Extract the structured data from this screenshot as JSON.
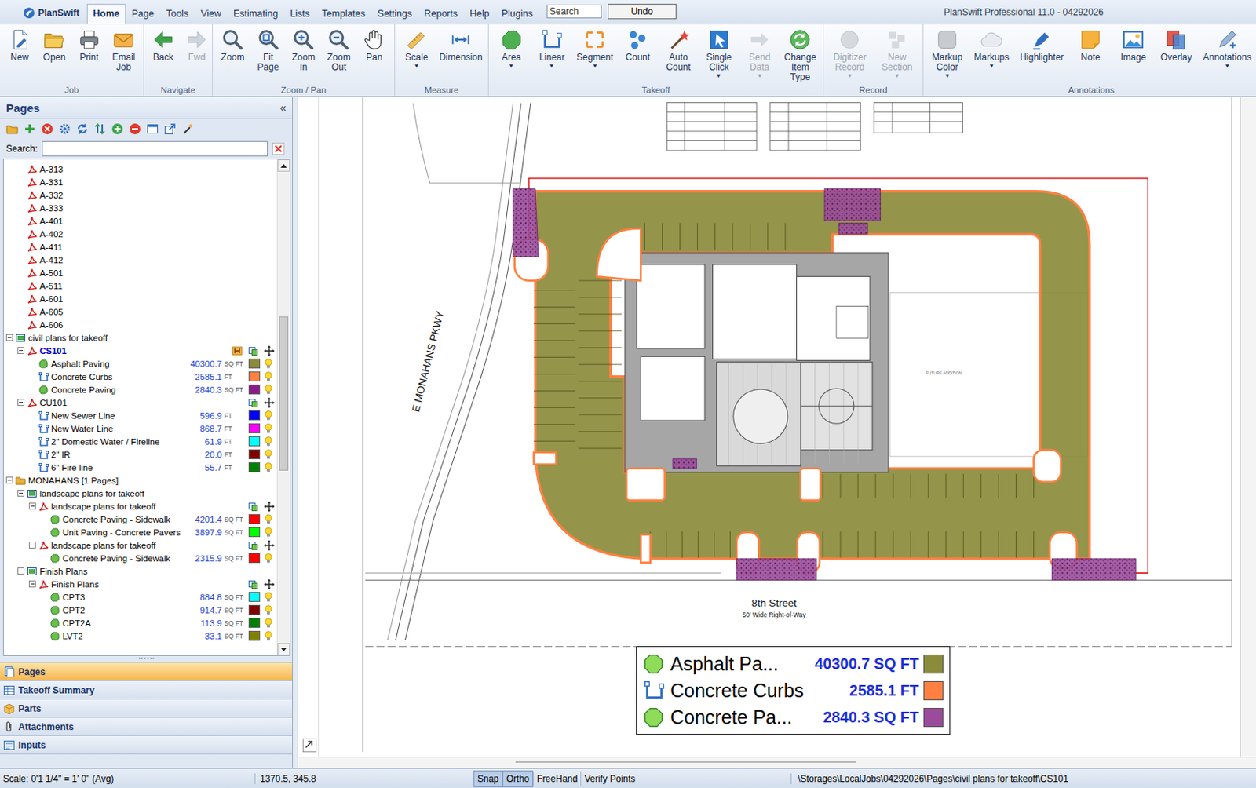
{
  "window": {
    "title": "PlanSwift Professional 11.0 - 04292026"
  },
  "menu": {
    "app": "PlanSwift",
    "tabs": [
      {
        "label": "Home",
        "selected": true
      },
      {
        "label": "Page",
        "selected": false
      },
      {
        "label": "Tools",
        "selected": false
      },
      {
        "label": "View",
        "selected": false
      },
      {
        "label": "Estimating",
        "selected": false
      },
      {
        "label": "Lists",
        "selected": false
      },
      {
        "label": "Templates",
        "selected": false
      },
      {
        "label": "Settings",
        "selected": false
      },
      {
        "label": "Reports",
        "selected": false
      },
      {
        "label": "Help",
        "selected": false
      },
      {
        "label": "Plugins",
        "selected": false
      }
    ],
    "search": {
      "placeholder": "Search"
    },
    "undo": "Undo"
  },
  "ribbon": {
    "groups": [
      {
        "label": "Job",
        "buttons": [
          {
            "label": "New",
            "disabled": false
          },
          {
            "label": "Open",
            "disabled": false
          },
          {
            "label": "Print",
            "disabled": false
          },
          {
            "label": "Email Job",
            "disabled": false
          }
        ]
      },
      {
        "label": "Navigate",
        "buttons": [
          {
            "label": "Back",
            "disabled": false
          },
          {
            "label": "Fwd",
            "disabled": true
          }
        ]
      },
      {
        "label": "Zoom / Pan",
        "buttons": [
          {
            "label": "Zoom",
            "disabled": false
          },
          {
            "label": "Fit Page",
            "disabled": false
          },
          {
            "label": "Zoom In",
            "disabled": false
          },
          {
            "label": "Zoom Out",
            "disabled": false
          },
          {
            "label": "Pan",
            "disabled": false
          }
        ]
      },
      {
        "label": "Measure",
        "buttons": [
          {
            "label": "Scale",
            "disabled": false,
            "arrow": "▾"
          },
          {
            "label": "Dimension",
            "disabled": false
          }
        ]
      },
      {
        "label": "Takeoff",
        "buttons": [
          {
            "label": "Area",
            "disabled": false,
            "arrow": "▾"
          },
          {
            "label": "Linear",
            "disabled": false,
            "arrow": "▾"
          },
          {
            "label": "Segment",
            "disabled": false,
            "arrow": "▾"
          },
          {
            "label": "Count",
            "disabled": false
          },
          {
            "label": "Auto Count",
            "disabled": false
          },
          {
            "label": "Single Click",
            "disabled": false,
            "arrow": "▾"
          },
          {
            "label": "Send Data",
            "disabled": true,
            "arrow": "▾"
          },
          {
            "label": "Change Item Type",
            "disabled": false
          }
        ]
      },
      {
        "label": "Record",
        "buttons": [
          {
            "label": "Digitizer Record",
            "disabled": true,
            "arrow": "▾"
          },
          {
            "label": "New Section",
            "disabled": true,
            "arrow": "▾"
          }
        ]
      },
      {
        "label": "Annotations",
        "buttons": [
          {
            "label": "Markup Color",
            "disabled": false,
            "arrow": "▾"
          },
          {
            "label": "Markups",
            "disabled": false,
            "arrow": "▾"
          },
          {
            "label": "Highlighter",
            "disabled": false
          },
          {
            "label": "Note",
            "disabled": false
          },
          {
            "label": "Image",
            "disabled": false
          },
          {
            "label": "Overlay",
            "disabled": false
          },
          {
            "label": "Annotations",
            "disabled": false,
            "arrow": "▾"
          }
        ]
      }
    ]
  },
  "pages_panel": {
    "title": "Pages",
    "collapse": "«",
    "search_label": "Search:",
    "tree": [
      {
        "label": "A-313",
        "level": 1,
        "kind": "pdf",
        "selected": false
      },
      {
        "label": "A-331",
        "level": 1,
        "kind": "pdf",
        "selected": false
      },
      {
        "label": "A-332",
        "level": 1,
        "kind": "pdf",
        "selected": false
      },
      {
        "label": "A-333",
        "level": 1,
        "kind": "pdf",
        "selected": false
      },
      {
        "label": "A-401",
        "level": 1,
        "kind": "pdf",
        "selected": false
      },
      {
        "label": "A-402",
        "level": 1,
        "kind": "pdf",
        "selected": false
      },
      {
        "label": "A-411",
        "level": 1,
        "kind": "pdf",
        "selected": false
      },
      {
        "label": "A-412",
        "level": 1,
        "kind": "pdf",
        "selected": false
      },
      {
        "label": "A-501",
        "level": 1,
        "kind": "pdf",
        "selected": false
      },
      {
        "label": "A-511",
        "level": 1,
        "kind": "pdf",
        "selected": false
      },
      {
        "label": "A-601",
        "level": 1,
        "kind": "pdf",
        "selected": false
      },
      {
        "label": "A-605",
        "level": 1,
        "kind": "pdf",
        "selected": false
      },
      {
        "label": "A-606",
        "level": 1,
        "kind": "pdf",
        "selected": false
      },
      {
        "label": "civil plans for takeoff",
        "level": 0,
        "kind": "job",
        "expanded": true,
        "selected": false
      },
      {
        "label": "CS101",
        "level": 1,
        "kind": "pdf",
        "expanded": true,
        "selected": true,
        "page_tools": true,
        "flagged": true
      },
      {
        "label": "Asphalt Paving",
        "level": 2,
        "kind": "area",
        "value": "40300.7",
        "unit": "SQ FT",
        "color": "#8b8b3c",
        "visible": true,
        "selected": false
      },
      {
        "label": "Concrete Curbs",
        "level": 2,
        "kind": "linear",
        "value": "2585.1",
        "unit": "FT",
        "color": "#ff8040",
        "visible": true,
        "selected": false
      },
      {
        "label": "Concrete Paving",
        "level": 2,
        "kind": "area",
        "value": "2840.3",
        "unit": "SQ FT",
        "color": "#8b1a8b",
        "visible": true,
        "selected": false
      },
      {
        "label": "CU101",
        "level": 1,
        "kind": "pdf",
        "expanded": true,
        "selected": false,
        "page_tools": true,
        "flagged": false
      },
      {
        "label": "New Sewer Line",
        "level": 2,
        "kind": "linear",
        "value": "596.9",
        "unit": "FT",
        "color": "#0000ff",
        "visible": true,
        "selected": false
      },
      {
        "label": "New Water Line",
        "level": 2,
        "kind": "linear",
        "value": "868.7",
        "unit": "FT",
        "color": "#ff00ff",
        "visible": true,
        "selected": false
      },
      {
        "label": "2\" Domestic Water / Fireline",
        "level": 2,
        "kind": "linear",
        "value": "61.9",
        "unit": "FT",
        "color": "#00ffff",
        "visible": true,
        "selected": false
      },
      {
        "label": "2\" IR",
        "level": 2,
        "kind": "linear",
        "value": "20.0",
        "unit": "FT",
        "color": "#800000",
        "visible": true,
        "selected": false
      },
      {
        "label": "6\" Fire line",
        "level": 2,
        "kind": "linear",
        "value": "55.7",
        "unit": "FT",
        "color": "#008000",
        "visible": true,
        "selected": false
      },
      {
        "label": "MONAHANS [1 Pages]",
        "level": 0,
        "kind": "folder",
        "expanded": true,
        "selected": false
      },
      {
        "label": "landscape plans for takeoff",
        "level": 1,
        "kind": "job",
        "expanded": true,
        "selected": false
      },
      {
        "label": "landscape plans for takeoff",
        "level": 2,
        "kind": "pdf",
        "expanded": true,
        "selected": false,
        "page_tools": true,
        "flagged": false
      },
      {
        "label": "Concrete Paving - Sidewalk",
        "level": 3,
        "kind": "area",
        "value": "4201.4",
        "unit": "SQ FT",
        "color": "#ff0000",
        "visible": true,
        "selected": false
      },
      {
        "label": "Unit Paving - Concrete Pavers",
        "level": 3,
        "kind": "area",
        "value": "3897.9",
        "unit": "SQ FT",
        "color": "#00ff00",
        "visible": true,
        "selected": false
      },
      {
        "label": "landscape plans for takeoff",
        "level": 2,
        "kind": "pdf",
        "expanded": true,
        "selected": false,
        "page_tools": true,
        "flagged": false
      },
      {
        "label": "Concrete Paving - Sidewalk",
        "level": 3,
        "kind": "area",
        "value": "2315.9",
        "unit": "SQ FT",
        "color": "#ff0000",
        "visible": true,
        "selected": false
      },
      {
        "label": "Finish Plans",
        "level": 1,
        "kind": "job",
        "expanded": true,
        "selected": false
      },
      {
        "label": "Finish Plans",
        "level": 2,
        "kind": "pdf",
        "expanded": true,
        "selected": false,
        "page_tools": true,
        "flagged": false
      },
      {
        "label": "CPT3",
        "level": 3,
        "kind": "area",
        "value": "884.8",
        "unit": "SQ FT",
        "color": "#00ffff",
        "visible": true,
        "selected": false
      },
      {
        "label": "CPT2",
        "level": 3,
        "kind": "area",
        "value": "914.7",
        "unit": "SQ FT",
        "color": "#800000",
        "visible": true,
        "selected": false
      },
      {
        "label": "CPT2A",
        "level": 3,
        "kind": "area",
        "value": "113.9",
        "unit": "SQ FT",
        "color": "#008000",
        "visible": true,
        "selected": false
      },
      {
        "label": "LVT2",
        "level": 3,
        "kind": "area",
        "value": "33.1",
        "unit": "SQ FT",
        "color": "#808000",
        "visible": true,
        "selected": false
      }
    ]
  },
  "accordion": [
    {
      "label": "Pages",
      "selected": true
    },
    {
      "label": "Takeoff Summary",
      "selected": false
    },
    {
      "label": "Parts",
      "selected": false
    },
    {
      "label": "Attachments",
      "selected": false
    },
    {
      "label": "Inputs",
      "selected": false
    }
  ],
  "canvas": {
    "road_label": "E MONAHANS PKWY",
    "street": "8th Street",
    "street_note": "50' Wide Right-of-Way",
    "future": "FUTURE ADDITION",
    "legend": [
      {
        "name": "Asphalt Pa...",
        "value": "40300.7",
        "unit": "SQ FT",
        "color": "#8b8b3c",
        "kind": "area"
      },
      {
        "name": "Concrete Curbs",
        "value": "2585.1",
        "unit": "FT",
        "color": "#ff8040",
        "kind": "linear"
      },
      {
        "name": "Concrete Pa...",
        "value": "2840.3",
        "unit": "SQ FT",
        "color": "#9b4b9b",
        "kind": "area"
      }
    ]
  },
  "status_bar": {
    "scale": "Scale: 0'1 1/4\" = 1' 0\" (Avg)",
    "coords": "1370.5, 345.8",
    "toggles": [
      {
        "label": "Snap",
        "on": true
      },
      {
        "label": "Ortho",
        "on": true
      },
      {
        "label": "FreeHand",
        "on": false
      },
      {
        "label": "Verify Points",
        "on": false
      }
    ],
    "path": "\\Storages\\LocalJobs\\04292026\\Pages\\civil plans for takeoff\\CS101"
  }
}
